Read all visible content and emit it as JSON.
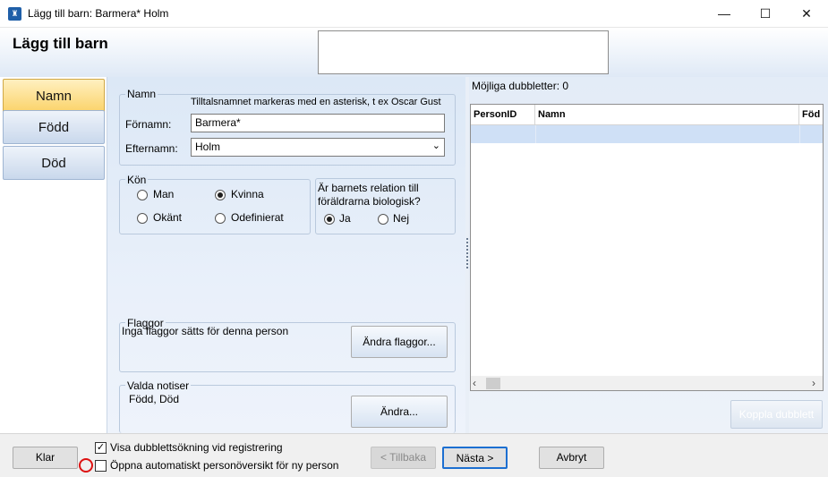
{
  "window": {
    "title": "Lägg till barn: Barmera* Holm",
    "app_icon": "tree-icon",
    "controls": {
      "minimize": "—",
      "maximize": "☐",
      "close": "✕"
    }
  },
  "header": {
    "title": "Lägg till barn"
  },
  "nav": {
    "items": [
      {
        "label": "Namn",
        "active": true
      },
      {
        "label": "Född",
        "active": false
      },
      {
        "label": "Död",
        "active": false
      }
    ]
  },
  "namn_group": {
    "legend": "Namn",
    "hint": "Tilltalsnamnet markeras med en asterisk, t ex  Oscar Gust",
    "fornamn_label": "Förnamn:",
    "fornamn_value": "Barmera*",
    "efternamn_label": "Efternamn:",
    "efternamn_value": "Holm"
  },
  "kon_group": {
    "legend": "Kön",
    "options": [
      {
        "label": "Man",
        "checked": false
      },
      {
        "label": "Kvinna",
        "checked": true
      },
      {
        "label": "Okänt",
        "checked": false
      },
      {
        "label": "Odefinierat",
        "checked": false
      }
    ]
  },
  "relation_group": {
    "question": "Är barnets relation till föräldrarna biologisk?",
    "options": [
      {
        "label": "Ja",
        "checked": true
      },
      {
        "label": "Nej",
        "checked": false
      }
    ]
  },
  "flaggor_group": {
    "legend": "Flaggor",
    "text": "Inga flaggor sätts för denna person",
    "button": "Ändra flaggor..."
  },
  "notiser_group": {
    "legend": "Valda notiser",
    "text": "Född, Död",
    "button": "Ändra..."
  },
  "duplicates": {
    "label": "Möjliga dubbletter: 0",
    "columns": [
      "PersonID",
      "Namn",
      "Föd"
    ],
    "merge_button": "Koppla dubblett"
  },
  "bottom": {
    "klar": "Klar",
    "check1_label": "Visa dubblettsökning vid registrering",
    "check1_checked": true,
    "check2_label": "Öppna automatiskt personöversikt för ny person",
    "check2_checked": false,
    "back": "< Tillbaka",
    "next": "Nästa >",
    "cancel": "Avbryt"
  }
}
